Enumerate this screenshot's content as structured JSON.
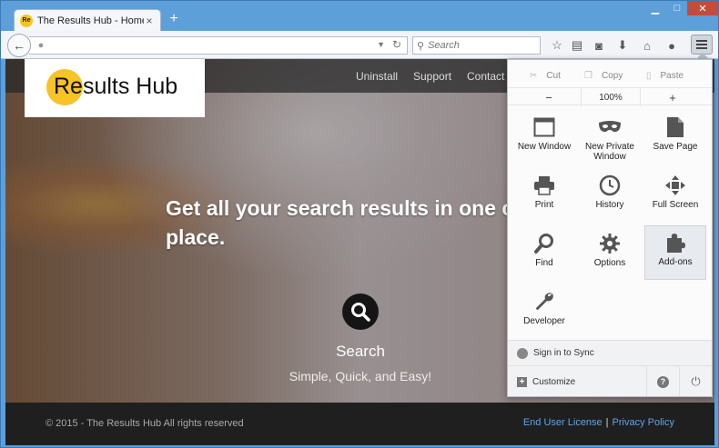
{
  "browser": {
    "tab_title": "The Results Hub - Home P...",
    "tab_favicon_text": "Re",
    "search_placeholder": "Search"
  },
  "page": {
    "logo_text": "Results Hub",
    "nav": [
      "Uninstall",
      "Support",
      "Contact"
    ],
    "hero_title": "Get all your search results in one click in one place.",
    "hero_title_visible": "Get all your search results in one c place.",
    "search_label": "Search",
    "search_sub": "Simple, Quick, and Easy!",
    "footer_copy": "© 2015 - The Results Hub All rights reserved",
    "footer_link_1": "End User License",
    "footer_link_2": "Privacy Policy"
  },
  "menu": {
    "cut": "Cut",
    "copy": "Copy",
    "paste": "Paste",
    "zoom_out": "−",
    "zoom_value": "100%",
    "zoom_in": "+",
    "items": [
      {
        "label": "New Window",
        "icon": "window-icon"
      },
      {
        "label": "New Private Window",
        "icon": "mask-icon"
      },
      {
        "label": "Save Page",
        "icon": "page-icon"
      },
      {
        "label": "Print",
        "icon": "printer-icon"
      },
      {
        "label": "History",
        "icon": "clock-icon"
      },
      {
        "label": "Full Screen",
        "icon": "fullscreen-icon"
      },
      {
        "label": "Find",
        "icon": "magnifier-icon"
      },
      {
        "label": "Options",
        "icon": "gear-icon"
      },
      {
        "label": "Add-ons",
        "icon": "puzzle-icon"
      },
      {
        "label": "Developer",
        "icon": "wrench-icon"
      }
    ],
    "sync": "Sign in to Sync",
    "customize": "Customize"
  },
  "colors": {
    "titlebar": "#5d9fd9",
    "brand_yellow": "#f7c326",
    "footer_link": "#5ea6e8"
  }
}
